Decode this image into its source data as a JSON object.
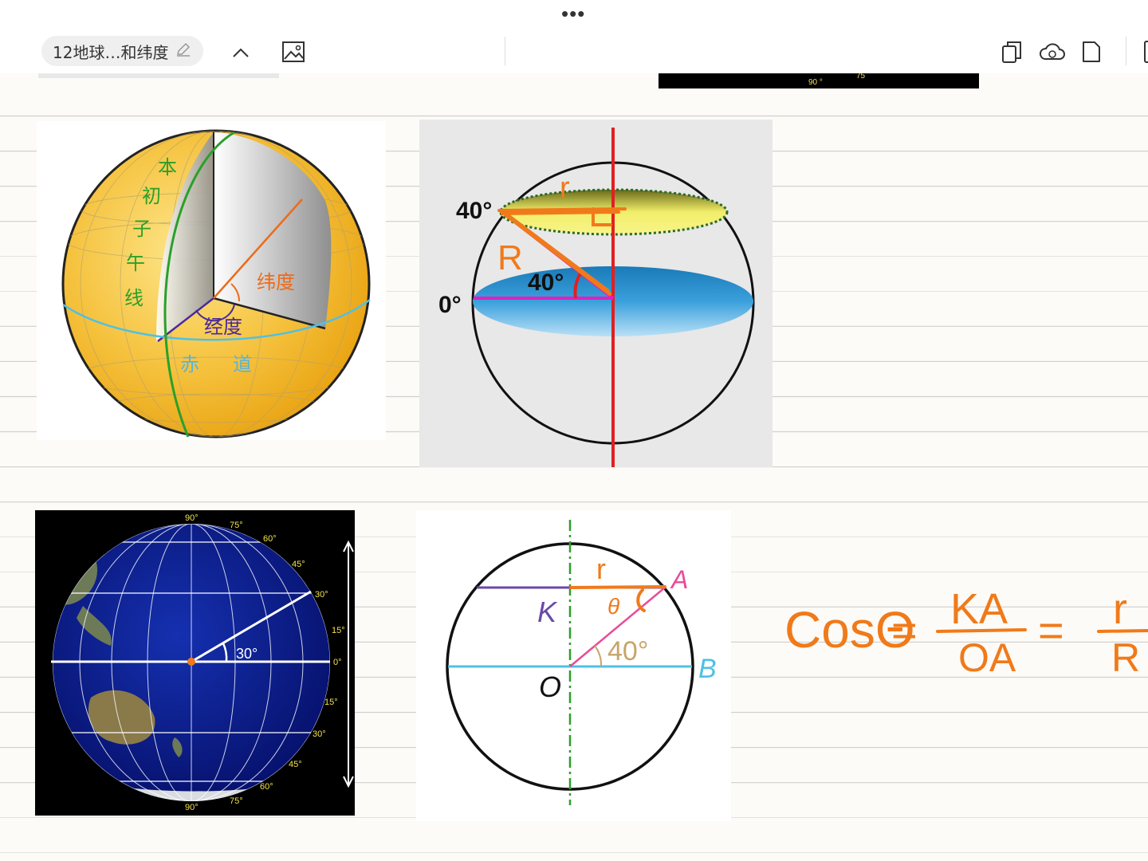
{
  "toolbar": {
    "more_label": "•••",
    "document_title": "12地球…和纬度"
  },
  "figure1": {
    "prime_meridian_label": [
      "本",
      "初",
      "子",
      "午",
      "线"
    ],
    "latitude_label": "纬度",
    "longitude_label": "经度",
    "equator_label": [
      "赤",
      "道"
    ]
  },
  "figure2": {
    "lat40_top": "40°",
    "lat40_center": "40°",
    "lat0": "0°",
    "hand_r": "r",
    "hand_R": "R"
  },
  "figure3": {
    "lat_labels": [
      "90°",
      "75°",
      "60°",
      "45°",
      "30°",
      "15°",
      "0°",
      "15°",
      "30°",
      "45°",
      "60°",
      "75°",
      "90°"
    ],
    "hand_angle": "30°"
  },
  "figure4": {
    "label_K": "K",
    "label_A": "A",
    "label_O": "O",
    "label_B": "B",
    "angle_40": "40°",
    "hand_r": "r",
    "hand_theta": "θ"
  },
  "handwriting": {
    "cos_theta": "CosΘ",
    "eq1": "=",
    "numerator1": "KA",
    "denominator1": "OA",
    "eq2": "=",
    "numerator2": "r",
    "denominator2": "R"
  },
  "colors": {
    "ink_orange": "#f07a1a",
    "globe_yellow": "#f5c13c",
    "ocean_blue": "#0a1a8c"
  }
}
